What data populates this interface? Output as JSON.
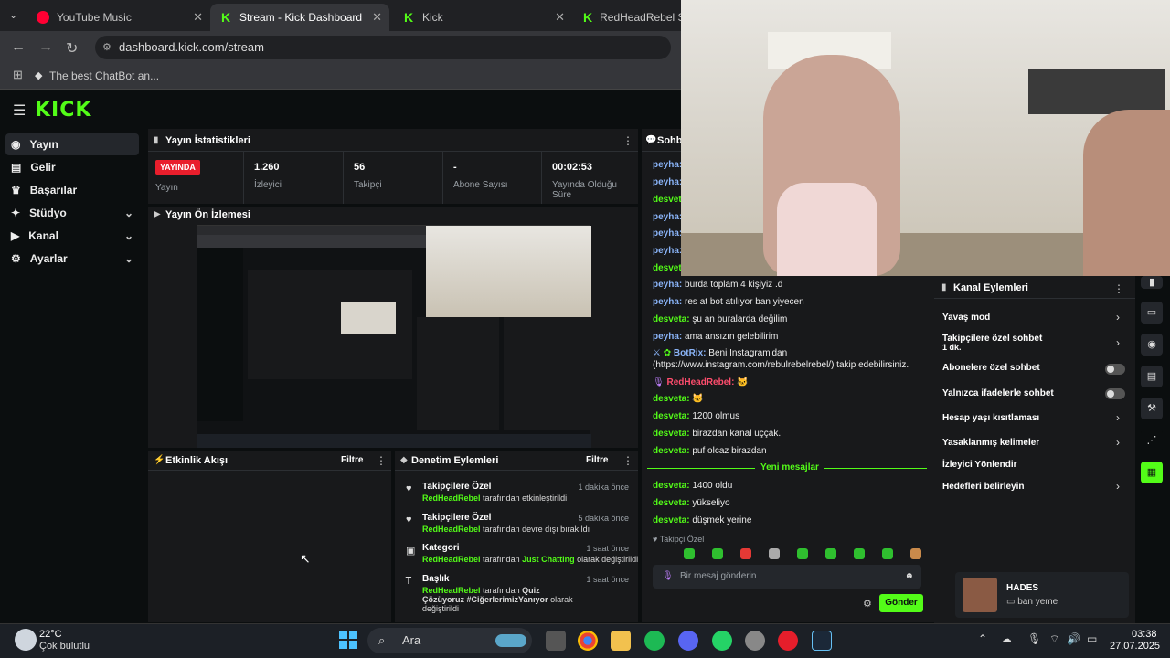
{
  "browser": {
    "tabs": [
      {
        "label": "YouTube Music",
        "icon": "youtube-music-icon"
      },
      {
        "label": "Stream - Kick Dashboard",
        "icon": "kick-icon",
        "active": true
      },
      {
        "label": "Kick",
        "icon": "kick-icon"
      },
      {
        "label": "RedHeadRebel Strea",
        "icon": "kick-icon"
      }
    ],
    "url": "dashboard.kick.com/stream",
    "bookmark": "The best ChatBot an..."
  },
  "sidebar": {
    "items": [
      {
        "label": "Yayın",
        "icon": "broadcast-icon"
      },
      {
        "label": "Gelir",
        "icon": "revenue-icon"
      },
      {
        "label": "Başarılar",
        "icon": "trophy-icon"
      },
      {
        "label": "Stüdyo",
        "icon": "studio-icon"
      },
      {
        "label": "Kanal",
        "icon": "channel-icon"
      },
      {
        "label": "Ayarlar",
        "icon": "gear-icon"
      }
    ]
  },
  "stats": {
    "title": "Yayın İstatistikleri",
    "live_badge": "YAYINDA",
    "live_label": "Yayın",
    "viewers_value": "1.260",
    "viewers_label": "İzleyici",
    "followers_value": "56",
    "followers_label": "Takipçi",
    "subs_value": "-",
    "subs_label": "Abone Sayısı",
    "duration_value": "00:02:53",
    "duration_label": "Yayında Olduğu Süre"
  },
  "preview": {
    "title": "Yayın Ön İzlemesi"
  },
  "activity": {
    "title": "Etkinlik Akışı",
    "filter": "Filtre"
  },
  "moderation": {
    "title": "Denetim Eylemleri",
    "filter": "Filtre",
    "rows": [
      {
        "title": "Takipçilere Özel",
        "user": "RedHeadRebel",
        "desc": "tarafından etkinleştirildi",
        "time": "1 dakika önce"
      },
      {
        "title": "Takipçilere Özel",
        "user": "RedHeadRebel",
        "desc": "tarafından devre dışı bırakıldı",
        "time": "5 dakika önce"
      },
      {
        "title": "Kategori",
        "user": "RedHeadRebel",
        "desc_pre": "tarafından",
        "highlight": "Just Chatting",
        "desc_post": "olarak değiştirildi",
        "time": "1 saat önce"
      },
      {
        "title": "Başlık",
        "user": "RedHeadRebel",
        "desc_pre": "tarafından",
        "highlight": "Quiz Çözüyoruz #CiğerlerimizYanıyor",
        "desc_post": "olarak değiştirildi",
        "time": "1 saat önce"
      }
    ]
  },
  "chat": {
    "title": "Sohbet",
    "lines": [
      {
        "user": "peyha",
        "text": "burda toplam 4 kişiyiz .d"
      },
      {
        "user": "peyha",
        "text": "res at bot atılıyor ban yiyecen"
      },
      {
        "user": "desveta",
        "text": "şu an buralarda değilim"
      },
      {
        "user": "peyha",
        "text": "ama ansızın gelebilirim"
      },
      {
        "user": "BotRix",
        "text": "Beni Instagram'dan"
      },
      {
        "user": "",
        "text": "(https://www.instagram.com/rebulrebelrebel/) takip edebilirsiniz."
      },
      {
        "user": "RedHeadRebel",
        "text": ""
      },
      {
        "user": "desveta",
        "text": ""
      },
      {
        "user": "desveta",
        "text": "1200 olmus"
      },
      {
        "user": "desveta",
        "text": "birazdan kanal uççak.."
      },
      {
        "user": "desveta",
        "text": "puf olcaz birazdan"
      },
      {
        "user": "desveta",
        "text": "1400 oldu"
      },
      {
        "user": "desveta",
        "text": "yükseliyo"
      },
      {
        "user": "desveta",
        "text": "düşmek yerine"
      }
    ],
    "new_messages": "Yeni mesajlar",
    "followers_only": "Takipçi Özel",
    "input_placeholder": "Bir mesaj gönderin",
    "send": "Gönder"
  },
  "channel_actions": {
    "title": "Kanal Eylemleri",
    "items": [
      {
        "label": "Yavaş mod",
        "control": "chevron"
      },
      {
        "label": "Takipçilere özel sohbet",
        "sub": "1 dk.",
        "control": "chevron"
      },
      {
        "label": "Abonelere özel sohbet",
        "control": "toggle"
      },
      {
        "label": "Yalnızca ifadelerle sohbet",
        "control": "toggle"
      },
      {
        "label": "Hesap yaşı kısıtlaması",
        "control": "chevron"
      },
      {
        "label": "Yasaklanmış kelimeler",
        "control": "chevron"
      },
      {
        "label": "İzleyici Yönlendir",
        "control": "none"
      },
      {
        "label": "Hedefleri belirleyin",
        "control": "chevron"
      }
    ]
  },
  "notification": {
    "name": "HADES",
    "text": "ban yeme"
  },
  "taskbar": {
    "temp": "22°C",
    "weather": "Çok bulutlu",
    "search": "Ara",
    "time": "03:38",
    "date": "27.07.2025"
  },
  "colors": {
    "kick_green": "#53fc18",
    "live_red": "#e91e2c",
    "panel": "#18191b"
  }
}
